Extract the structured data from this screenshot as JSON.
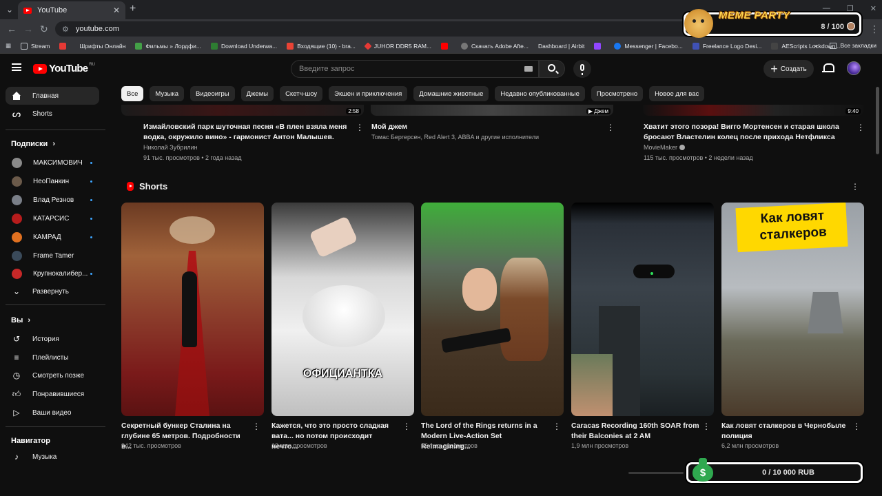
{
  "browser": {
    "tab_title": "YouTube",
    "url": "youtube.com",
    "bookmarks": [
      {
        "label": "Stream",
        "color": "#2b2b2b"
      },
      {
        "label": "",
        "color": "#e53935"
      },
      {
        "label": "Шрифты Онлайн",
        "color": "#2b2b2b"
      },
      {
        "label": "Фильмы » Лордфи...",
        "color": "#43a047"
      },
      {
        "label": "Download Underwa...",
        "color": "#2e7d32"
      },
      {
        "label": "Входящие (10) - bra...",
        "color": "#ea4335"
      },
      {
        "label": "JUHOR DDR5 RAM...",
        "color": "#e53935"
      },
      {
        "label": "",
        "color": "#ff0000"
      },
      {
        "label": "Скачать Adobe Afte...",
        "color": "#777777"
      },
      {
        "label": "Dashboard | Airbit",
        "color": "#1e1e3a"
      },
      {
        "label": "",
        "color": "#9146ff"
      },
      {
        "label": "Messenger | Facebo...",
        "color": "#1877f2"
      },
      {
        "label": "Freelance Logo Desi...",
        "color": "#3f51b5"
      },
      {
        "label": "AEScripts Lockdown...",
        "color": "#222222"
      }
    ],
    "all_bookmarks": "Все закладки"
  },
  "overlay": {
    "meme_title": "MEME PARTY",
    "meme_count": "8 / 100",
    "rub_progress": "0 / 10 000 RUB",
    "rub_icon": "$"
  },
  "header": {
    "logo_text": "YouTube",
    "region": "RU",
    "search_placeholder": "Введите запрос",
    "create_label": "Создать"
  },
  "sidebar": {
    "main": [
      {
        "label": "Главная",
        "icon": "home-icon"
      },
      {
        "label": "Shorts",
        "icon": "shorts-icon"
      }
    ],
    "subs_heading": "Подписки",
    "subscriptions": [
      {
        "label": "МАКСИМОВИЧ",
        "color": "#8a8a8a"
      },
      {
        "label": "НеоПанкин",
        "color": "#6b5a4a"
      },
      {
        "label": "Влад Резнов",
        "color": "#7a7f88"
      },
      {
        "label": "КАТАРСИС",
        "color": "#b71c1c"
      },
      {
        "label": "КАМРАД",
        "color": "#e07020"
      },
      {
        "label": "Frame Tamer",
        "color": "#3a4a5a"
      },
      {
        "label": "Крупнокалибер...",
        "color": "#c62828"
      }
    ],
    "expand_label": "Развернуть",
    "you_heading": "Вы",
    "you_items": [
      {
        "label": "История",
        "icon": "history-icon"
      },
      {
        "label": "Плейлисты",
        "icon": "playlists-icon"
      },
      {
        "label": "Смотреть позже",
        "icon": "watch-later-icon"
      },
      {
        "label": "Понравившиеся",
        "icon": "like-icon"
      },
      {
        "label": "Ваши видео",
        "icon": "your-videos-icon"
      }
    ],
    "nav_heading": "Навигатор",
    "nav_items": [
      {
        "label": "Музыка",
        "icon": "music-icon"
      }
    ]
  },
  "chips": [
    "Все",
    "Музыка",
    "Видеоигры",
    "Джемы",
    "Скетч-шоу",
    "Экшен и приключения",
    "Домашние животные",
    "Недавно опубликованные",
    "Просмотрено",
    "Новое для вас"
  ],
  "videos": [
    {
      "duration": "2:58",
      "title_line1": "Измайловский парк шуточная песня «В плен взяла меня",
      "title_line2": "водка, окружило вино» - гармонист Антон Малышев.",
      "channel": "Николай Зубрилин",
      "meta": "91 тыс. просмотров • 2 года назад"
    },
    {
      "duration": "Джем",
      "title_line1": "Мой джем",
      "title_line2": "",
      "channel": "Томас Бергерсен, Red Alert 3, ABBA и другие исполнители",
      "meta": ""
    },
    {
      "duration": "9:40",
      "title_line1": "Хватит этого позора! Вигго Мортенсен и старая школа",
      "title_line2": "бросают Властелин колец после прихода Нетфликса",
      "channel": "MovieMaker",
      "meta": "115 тыс. просмотров • 2 недели назад"
    }
  ],
  "shorts": {
    "heading": "Shorts",
    "items": [
      {
        "caption": "",
        "title_line1": "Секретный бункер Сталина на",
        "title_line2": "глубине 65 метров. Подробности в...",
        "views": "942 тыс. просмотров"
      },
      {
        "caption": "ОФИЦИАНТКА",
        "title_line1": "Кажется, что это просто сладкая",
        "title_line2": "вата... но потом происходит нечто...",
        "views": "13 млн просмотров"
      },
      {
        "caption": "",
        "title_line1": "The Lord of the Rings returns in a",
        "title_line2": "Modern Live-Action Set Reimagining...",
        "views": "66 тыс. просмотров"
      },
      {
        "caption": "",
        "title_line1": "Caracas Recording 160th SOAR from",
        "title_line2": "their Balconies at 2 AM",
        "views": "1,9 млн просмотров"
      },
      {
        "caption": "Как ловят сталкеров",
        "title_line1": "Как ловят сталкеров в Чернобыле",
        "title_line2": "полиция",
        "views": "6,2 млн просмотров"
      }
    ]
  }
}
